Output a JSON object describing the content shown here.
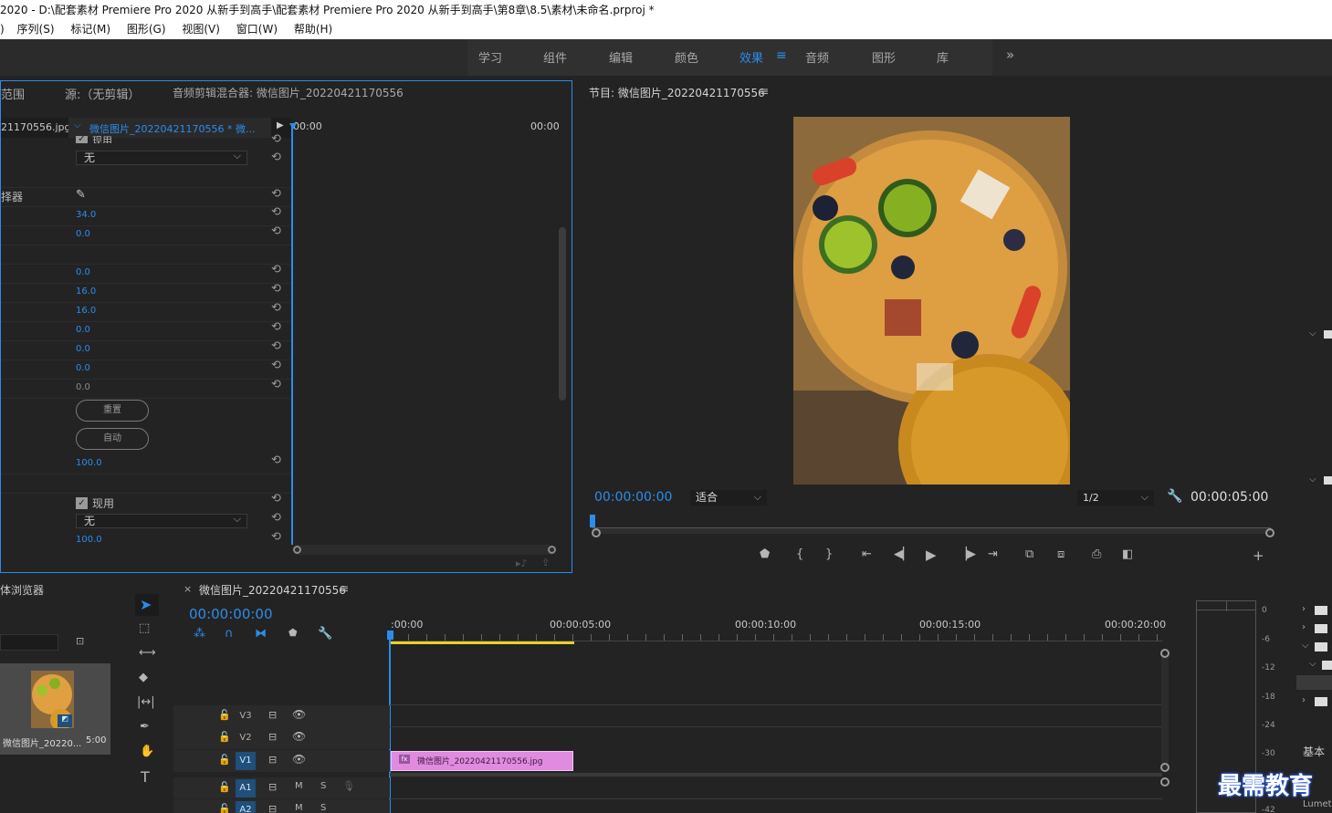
{
  "window": {
    "title": "2020 - D:\\配套素材 Premiere Pro 2020 从新手到高手\\配套素材 Premiere Pro 2020 从新手到高手\\第8章\\8.5\\素材\\未命名.prproj *"
  },
  "menu": [
    "序列(S)",
    "标记(M)",
    "图形(G)",
    "视图(V)",
    "窗口(W)",
    "帮助(H)"
  ],
  "menu_prefix": ")",
  "workspaces": [
    {
      "label": "学习"
    },
    {
      "label": "组件"
    },
    {
      "label": "编辑"
    },
    {
      "label": "颜色"
    },
    {
      "label": "效果",
      "active": true
    },
    {
      "label": "音频"
    },
    {
      "label": "图形"
    },
    {
      "label": "库"
    }
  ],
  "workspace_more": "»",
  "effect_controls": {
    "tabs": [
      "范围",
      "源:（无剪辑）",
      "音频剪辑混合器: 微信图片_20220421170556"
    ],
    "clip_name": "21170556.jpg",
    "seq_name": "微信图片_20220421170556 * 微...",
    "time_start": "00:00",
    "time_end": "00:00",
    "label_picker": "择器",
    "checkbox_label": "现用",
    "dropdown_value": "无",
    "values": [
      "34.0",
      "0.0",
      "0.0",
      "16.0",
      "16.0",
      "0.0",
      "0.0",
      "0.0",
      "0.0"
    ],
    "btn_reset": "重置",
    "btn_auto": "自动",
    "value_100a": "100.0",
    "checkbox_label2": "现用",
    "dropdown_value2": "无",
    "value_100b": "100.0"
  },
  "program": {
    "title": "节目: 微信图片_20220421170556",
    "timecode": "00:00:00:00",
    "fit": "适合",
    "resolution": "1/2",
    "duration": "00:00:05:00"
  },
  "project": {
    "title": "体浏览器",
    "item_name": "微信图片_20220...",
    "item_dur": "5:00"
  },
  "timeline": {
    "seq_tab": "微信图片_20220421170556",
    "timecode": "00:00:00:00",
    "ticks": [
      ":00:00",
      "00:00:05:00",
      "00:00:10:00",
      "00:00:15:00",
      "00:00:20:00"
    ],
    "tracks": [
      "V3",
      "V2",
      "V1",
      "A1",
      "A2"
    ],
    "clip": "微信图片_20220421170556.jpg",
    "m": "M",
    "s": "S"
  },
  "meters": {
    "db": [
      "0",
      "-6",
      "-12",
      "-18",
      "-24",
      "-30",
      "-36",
      "-42"
    ]
  },
  "right": {
    "label1": "基本",
    "label2": "Lumet"
  },
  "watermark": "最需教育",
  "colors": {
    "accent": "#2d8ceb",
    "clip": "#e08be0",
    "playrange": "#e8d31e"
  }
}
